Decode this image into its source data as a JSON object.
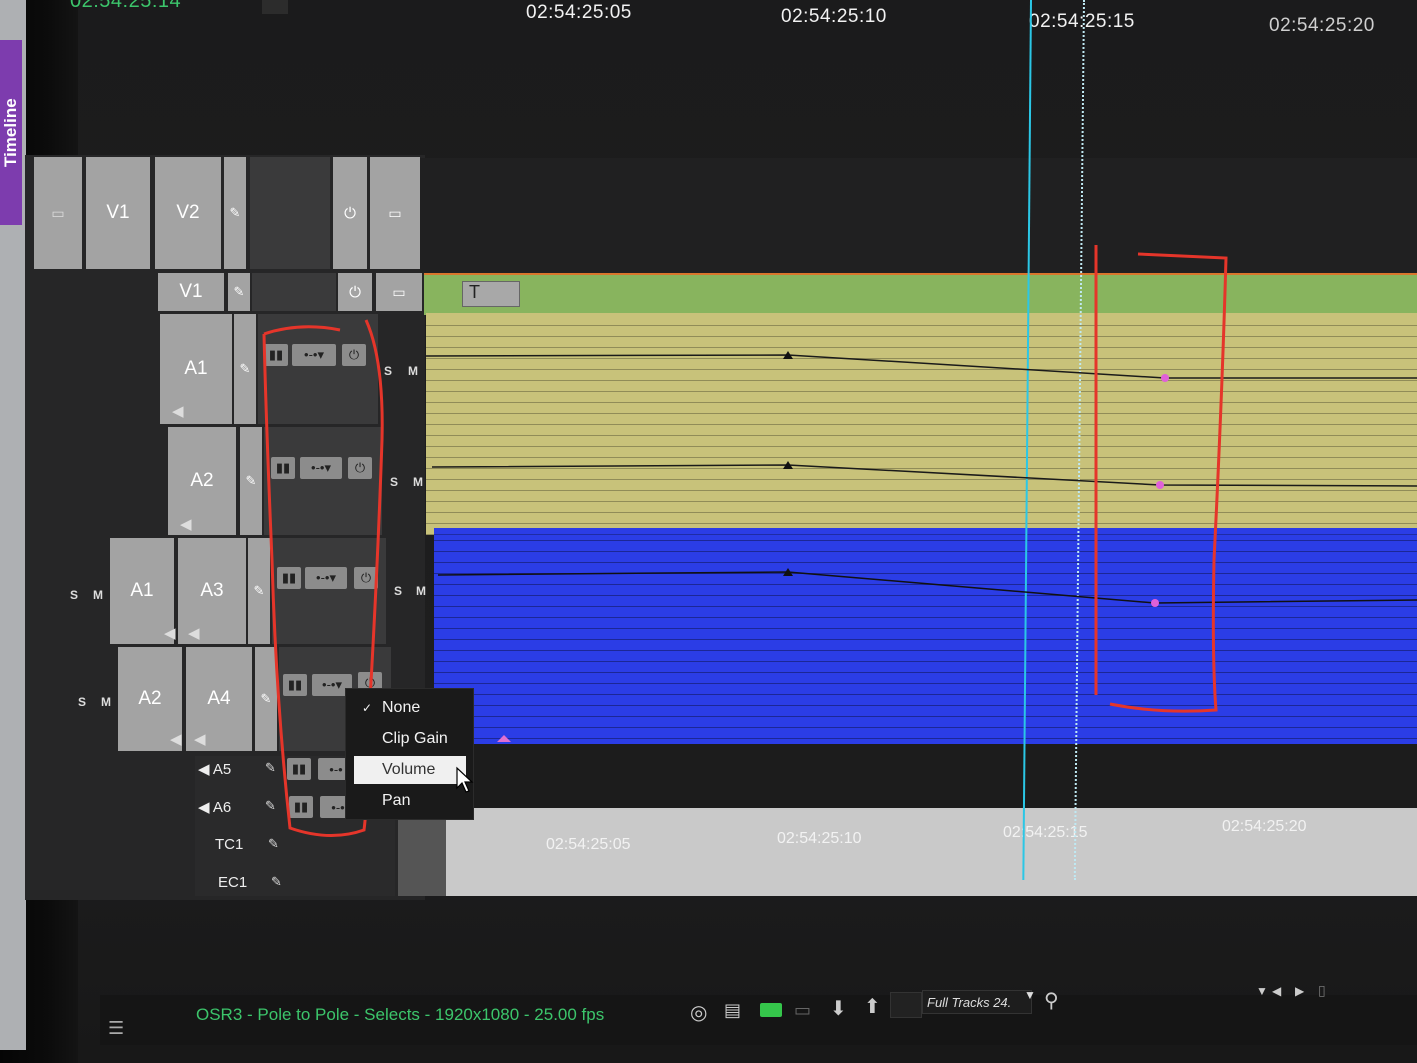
{
  "sidebar": {
    "tab_label": "Timeline"
  },
  "header": {
    "current_timecode": "02:54:25:14",
    "ruler_timecodes": [
      "02:54:25:05",
      "02:54:25:10",
      "02:54:25:15",
      "02:54:25:20"
    ]
  },
  "tracks": {
    "video": {
      "top_left": "V1",
      "top_right": "V2",
      "row2": "V1"
    },
    "audio": [
      {
        "label": "A1",
        "solo": "S",
        "mute": "M"
      },
      {
        "label": "A2",
        "solo": "S",
        "mute": "M"
      },
      {
        "label": "A3",
        "source": "A1",
        "solo": "S",
        "mute": "M"
      },
      {
        "label": "A4",
        "source": "A2",
        "solo": "S",
        "mute": "M"
      },
      {
        "label": "A5"
      },
      {
        "label": "A6"
      }
    ],
    "timecode_track": "TC1",
    "edgecode_track": "EC1"
  },
  "clip": {
    "title_icon": "T"
  },
  "context_menu": {
    "items": [
      "None",
      "Clip Gain",
      "Volume",
      "Pan"
    ],
    "checked": "None",
    "highlighted": "Volume"
  },
  "tc_ruler": [
    "02:54:25:05",
    "02:54:25:10",
    "02:54:25:15",
    "02:54:25:20"
  ],
  "status_bar": {
    "sequence_info": "OSR3 - Pole to Pole - Selects - 1920x1080 - 25.00 fps",
    "track_preset": "Full Tracks 24."
  },
  "colors": {
    "video_clip": "#88b45e",
    "audio_clip_yellow": "#c8c27a",
    "audio_clip_blue": "#2b3de6",
    "playhead": "#2bc7e6",
    "annotation_red": "#e5352a",
    "status_text": "#3cc56b"
  }
}
